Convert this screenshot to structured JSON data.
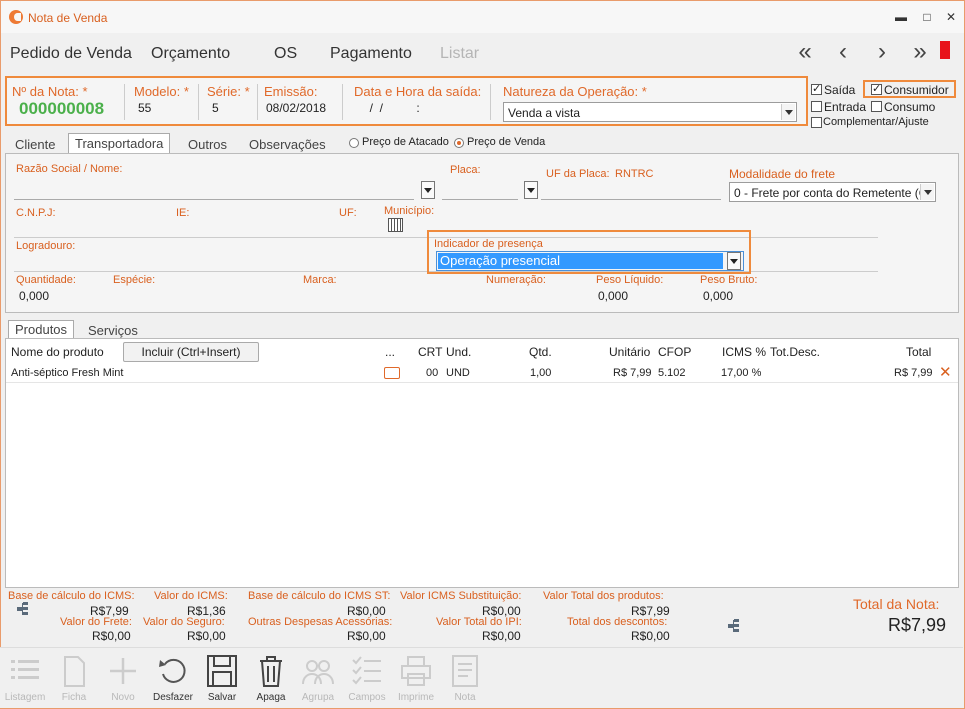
{
  "window": {
    "title": "Nota de Venda",
    "controls": {
      "minimize": "▬",
      "maximize": "□",
      "close": "✕"
    }
  },
  "menu": {
    "items": [
      "Pedido de Venda",
      "Orçamento",
      "OS",
      "Pagamento"
    ],
    "disabled_item": "Listar"
  },
  "nav": {
    "first": "«",
    "prev": "‹",
    "next": "›",
    "last": "»"
  },
  "header": {
    "nota_label": "Nº da Nota: *",
    "nota_value": "000000008",
    "modelo_label": "Modelo: *",
    "modelo_value": "55",
    "serie_label": "Série: *",
    "serie_value": "5",
    "emissao_label": "Emissão:",
    "emissao_value": "08/02/2018",
    "saida_label": "Data e Hora da saída:",
    "saida_value": "  /  /          :",
    "natureza_label": "Natureza da Operação: *",
    "natureza_value": "Venda a vista"
  },
  "flags": {
    "saida": "Saída",
    "entrada": "Entrada",
    "complementar": "Complementar/Ajuste",
    "consumidor": "Consumidor",
    "consumo": "Consumo"
  },
  "tabs": {
    "items": [
      "Cliente",
      "Transportadora",
      "Outros",
      "Observações"
    ],
    "active": "Transportadora"
  },
  "price_mode": {
    "atacado": "Preço de Atacado",
    "venda": "Preço de Venda"
  },
  "transport": {
    "razao_label": "Razão Social / Nome:",
    "placa_label": "Placa:",
    "uf_placa_label": "UF da Placa:",
    "rntrc_label": "RNTRC",
    "modalidade_label": "Modalidade do frete",
    "modalidade_value": "0 - Frete por conta do Remetente (C",
    "cnpj_label": "C.N.P.J:",
    "ie_label": "IE:",
    "uf_label": "UF:",
    "municipio_label": "Município:",
    "logradouro_label": "Logradouro:",
    "indicador_label": "Indicador de presença",
    "indicador_value": "Operação presencial",
    "quantidade_label": "Quantidade:",
    "quantidade_value": "0,000",
    "especie_label": "Espécie:",
    "marca_label": "Marca:",
    "numeracao_label": "Numeração:",
    "peso_liq_label": "Peso Líquido:",
    "peso_liq_value": "0,000",
    "peso_bruto_label": "Peso Bruto:",
    "peso_bruto_value": "0,000"
  },
  "product_tabs": {
    "items": [
      "Produtos",
      "Serviços"
    ],
    "active": "Produtos"
  },
  "products": {
    "incluir_label": "Incluir (Ctrl+Insert)",
    "columns": {
      "nome": "Nome do produto",
      "dots": "...",
      "crt": "CRT",
      "und": "Und.",
      "qtd": "Qtd.",
      "unitario": "Unitário",
      "cfop": "CFOP",
      "icms": "ICMS %",
      "totdesc": "Tot.Desc.",
      "total": "Total"
    },
    "rows": [
      {
        "nome": "Anti-séptico Fresh Mint",
        "crt": "00",
        "und": "UND",
        "qtd": "1,00",
        "unitario": "R$ 7,99",
        "cfop": "5.102",
        "icms": "17,00 %",
        "totdesc": "",
        "total": "R$ 7,99"
      }
    ]
  },
  "totals": {
    "base_icms_label": "Base de cálculo do ICMS:",
    "base_icms_value": "R$7,99",
    "valor_icms_label": "Valor do ICMS:",
    "valor_icms_value": "R$1,36",
    "base_icms_st_label": "Base de cálculo do ICMS ST:",
    "base_icms_st_value": "R$0,00",
    "valor_icms_sub_label": "Valor ICMS Substituição:",
    "valor_icms_sub_value": "R$0,00",
    "valor_total_prod_label": "Valor Total dos produtos:",
    "valor_total_prod_value": "R$7,99",
    "valor_frete_label": "Valor do Frete:",
    "valor_frete_value": "R$0,00",
    "valor_seguro_label": "Valor do Seguro:",
    "valor_seguro_value": "R$0,00",
    "outras_desp_label": "Outras Despesas Acessórias:",
    "outras_desp_value": "R$0,00",
    "valor_ipi_label": "Valor Total do IPI:",
    "valor_ipi_value": "R$0,00",
    "total_desc_label": "Total dos descontos:",
    "total_desc_value": "R$0,00",
    "total_nota_label": "Total da Nota:",
    "total_nota_value": "R$7,99"
  },
  "toolbar": {
    "listagem": "Listagem",
    "ficha": "Ficha",
    "novo": "Novo",
    "desfazer": "Desfazer",
    "salvar": "Salvar",
    "apaga": "Apaga",
    "agrupa": "Agrupa",
    "campos": "Campos",
    "imprime": "Imprime",
    "nota": "Nota"
  },
  "colors": {
    "accent": "#ef8a3c",
    "label": "#d9601f",
    "green": "#4bb04b",
    "selection": "#3399ff",
    "red": "#e8131b"
  }
}
